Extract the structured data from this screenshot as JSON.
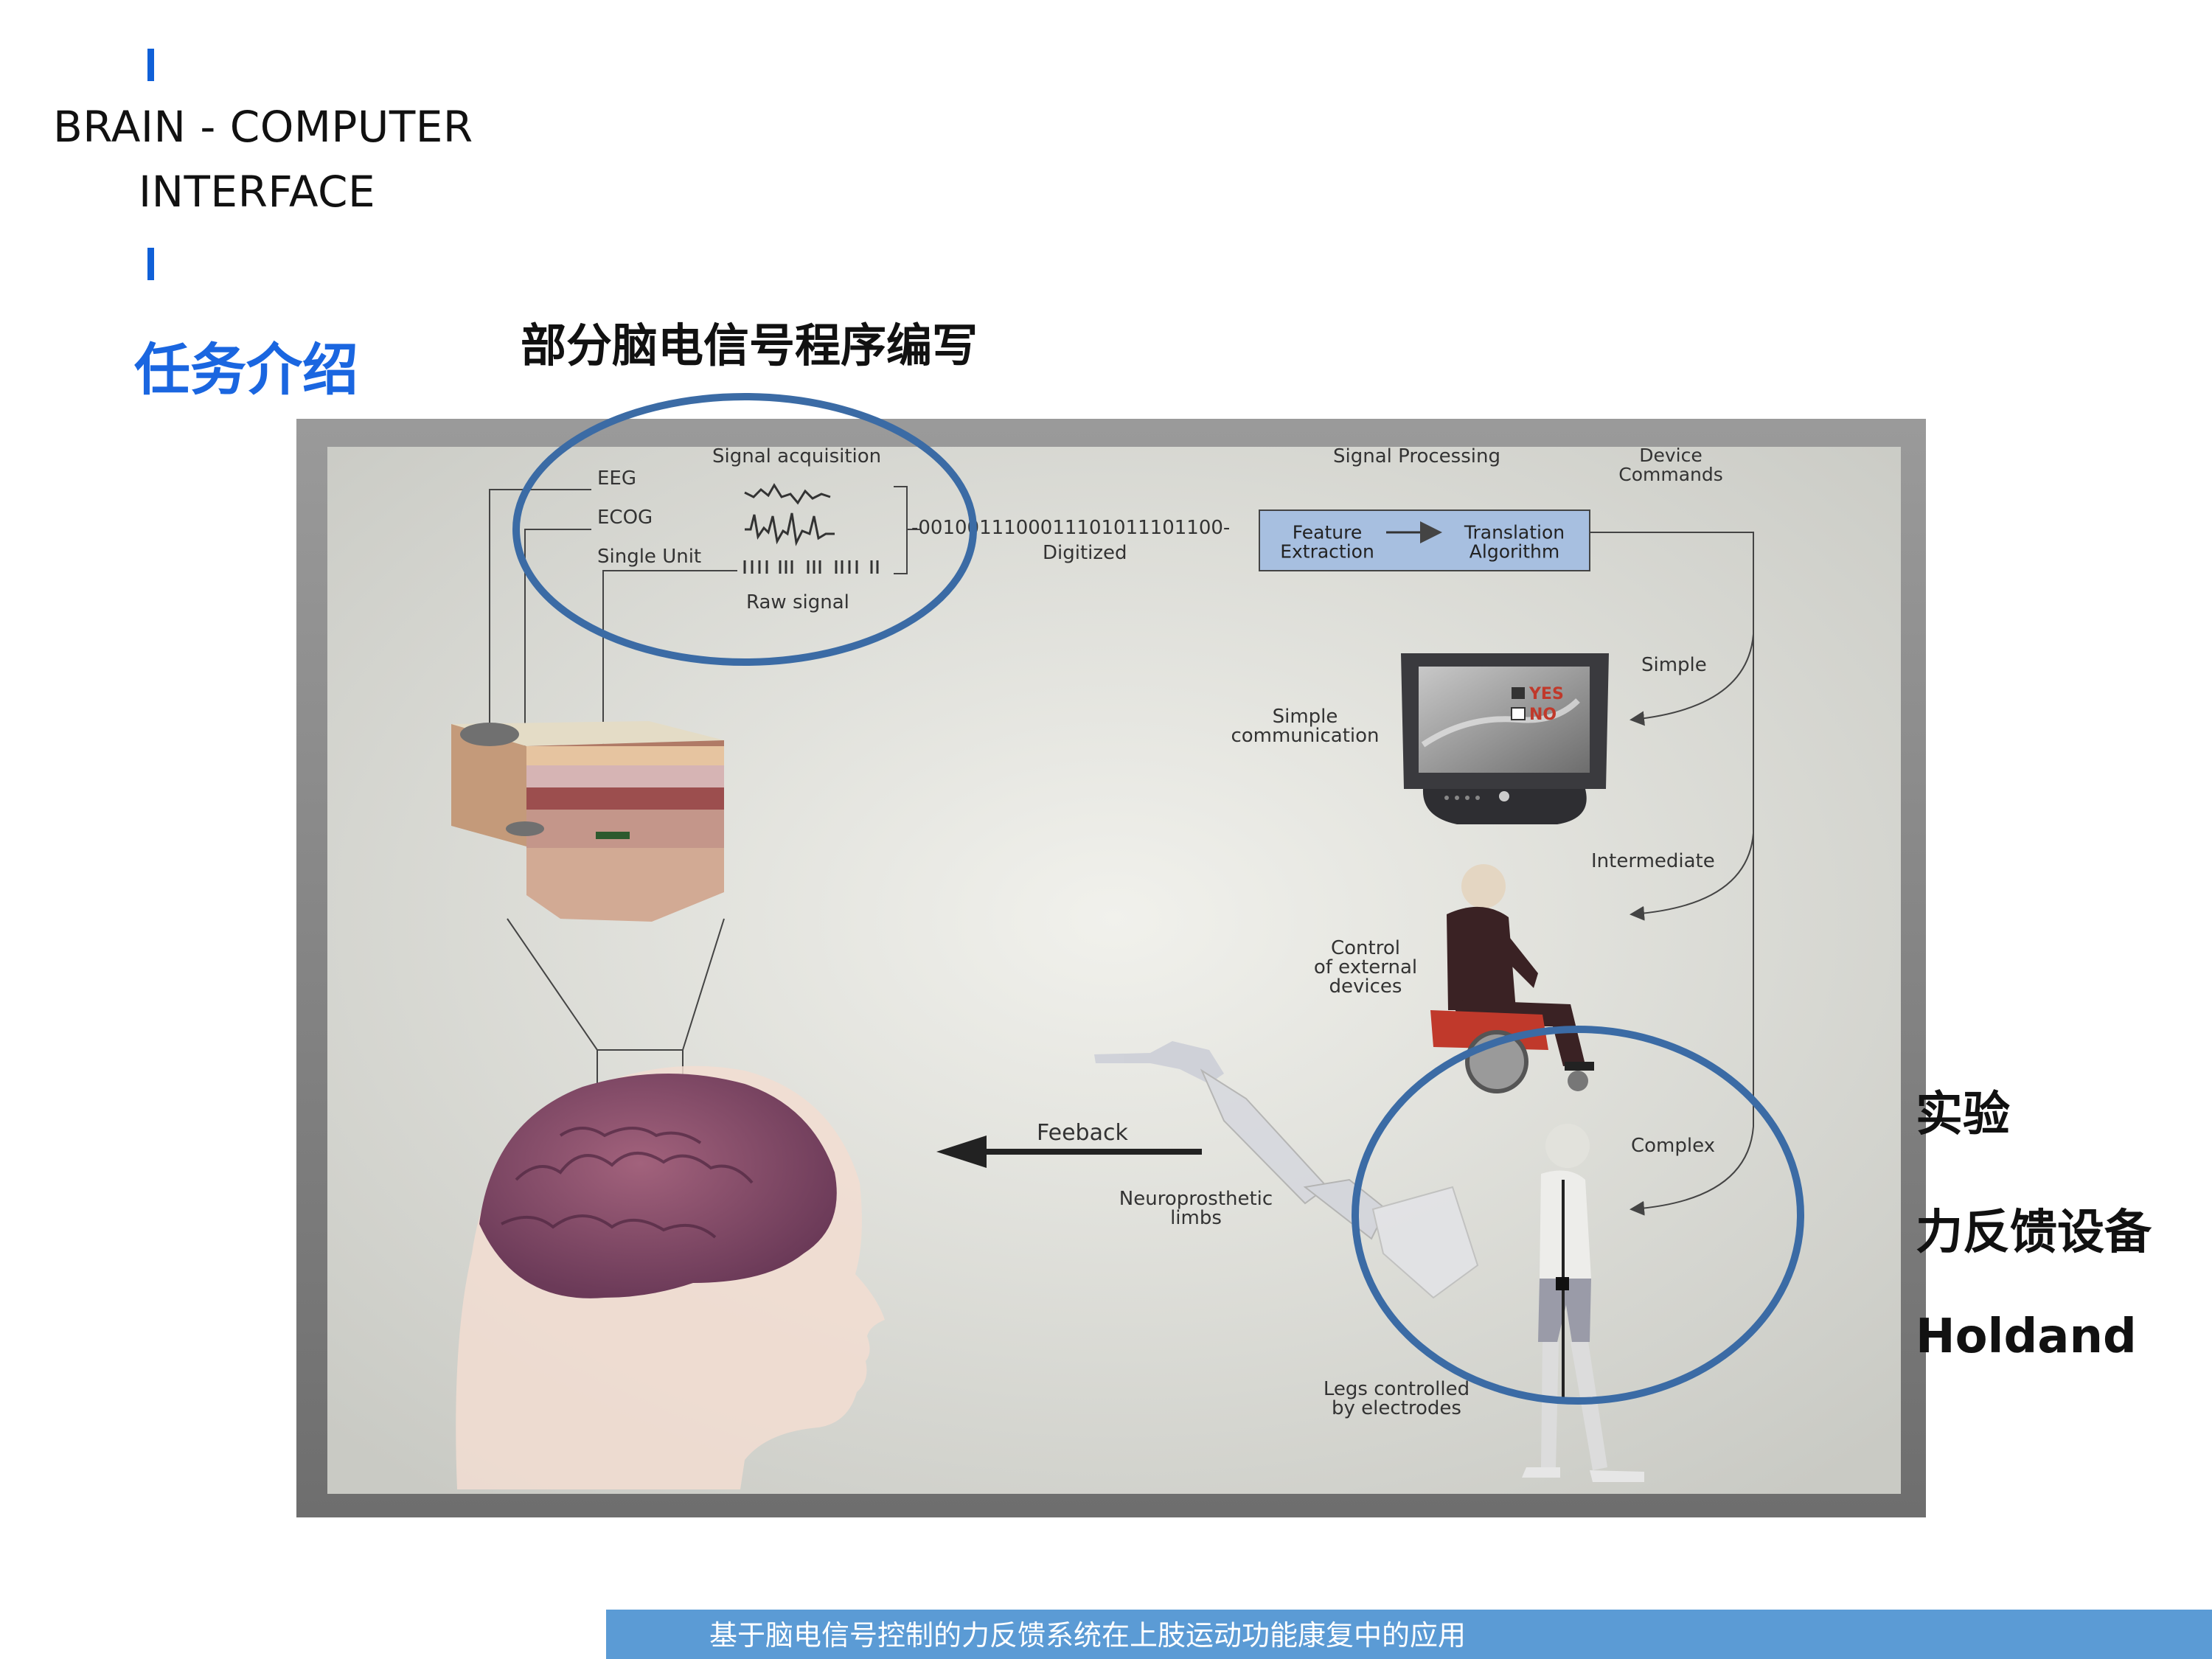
{
  "header": {
    "brand_line1": "BRAIN - COMPUTER",
    "brand_line2": "INTERFACE",
    "section_title": "任务介绍",
    "headline": "部分脑电信号程序编写"
  },
  "figure": {
    "signal_acquisition": "Signal acquisition",
    "eeg": "EEG",
    "ecog": "ECOG",
    "single_unit": "Single Unit",
    "raw_signal": "Raw signal",
    "binary": "-0010011100011101011101100-",
    "digitized": "Digitized",
    "signal_processing": "Signal Processing",
    "device_commands_1": "Device",
    "device_commands_2": "Commands",
    "feature_extraction_1": "Feature",
    "feature_extraction_2": "Extraction",
    "translation_algorithm_1": "Translation",
    "translation_algorithm_2": "Algorithm",
    "simple": "Simple",
    "simple_comm_1": "Simple",
    "simple_comm_2": "communication",
    "yes": "YES",
    "no": "NO",
    "intermediate": "Intermediate",
    "control_1": "Control",
    "control_2": "of external",
    "control_3": "devices",
    "complex": "Complex",
    "feedback": "Feeback",
    "neuro_1": "Neuroprosthetic",
    "neuro_2": "limbs",
    "legs_1": "Legs controlled",
    "legs_2": "by electrodes"
  },
  "side_labels": [
    "实验",
    "力反馈设备",
    "Holdand"
  ],
  "footer": {
    "text": "基于脑电信号控制的力反馈系统在上肢运动功能康复中的应用"
  },
  "colors": {
    "accent_blue": "#1a66e0",
    "circle_blue": "#3b6ba5",
    "footer_blue": "#5b9bd5",
    "processing_box": "#a7bfe0"
  }
}
